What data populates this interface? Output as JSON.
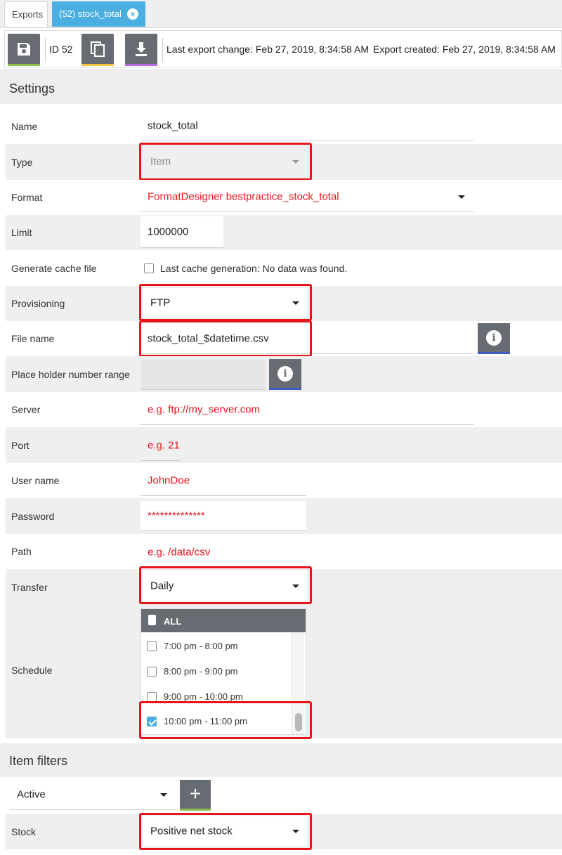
{
  "tabs": [
    {
      "label": "Exports"
    },
    {
      "label": "(52) stock_total",
      "close_icon": "close-circle-icon"
    }
  ],
  "toolbar": {
    "save_icon": "floppy-disk-icon",
    "id_text": "ID 52",
    "copy_icon": "copy-icon",
    "download_icon": "download-icon",
    "last_change": "Last export change: Feb 27, 2019, 8:34:58 AM",
    "created": "Export created: Feb 27, 2019, 8:34:58 AM",
    "colors": {
      "save": "#8bc34a",
      "copy": "#f5c542",
      "download": "#b86be0"
    }
  },
  "settings": {
    "title": "Settings",
    "name": {
      "label": "Name",
      "value": "stock_total"
    },
    "type": {
      "label": "Type",
      "value": "Item"
    },
    "format": {
      "label": "Format",
      "value": "FormatDesigner bestpractice_stock_total"
    },
    "limit": {
      "label": "Limit",
      "value": "1000000"
    },
    "cache": {
      "label": "Generate cache file",
      "text": "Last cache generation: No data was found."
    },
    "provisioning": {
      "label": "Provisioning",
      "value": "FTP"
    },
    "file_name": {
      "label": "File name",
      "value": "stock_total_$datetime.csv"
    },
    "placeholder_range": {
      "label": "Place holder number range",
      "value": ""
    },
    "server": {
      "label": "Server",
      "value": "e.g. ftp://my_server.com"
    },
    "port": {
      "label": "Port",
      "value": "e.g. 21"
    },
    "user": {
      "label": "User name",
      "value": "JohnDoe"
    },
    "password": {
      "label": "Password",
      "value": "**************"
    },
    "path": {
      "label": "Path",
      "value": "e.g. /data/csv"
    },
    "transfer": {
      "label": "Transfer",
      "value": "Daily"
    },
    "schedule": {
      "label": "Schedule",
      "all_label": "ALL",
      "items": [
        {
          "label": "7:00 pm - 8:00 pm",
          "checked": false
        },
        {
          "label": "8:00 pm - 9:00 pm",
          "checked": false
        },
        {
          "label": "9:00 pm - 10:00 pm",
          "checked": false
        },
        {
          "label": "10:00 pm - 11:00 pm",
          "checked": true
        }
      ]
    }
  },
  "item_filters": {
    "title": "Item filters",
    "active_select": "Active",
    "add_label": "+",
    "stock": {
      "label": "Stock",
      "value": "Positive net stock"
    }
  },
  "colors": {
    "accent": "#4aaee0",
    "highlight": "#e8141c",
    "button": "#676b72"
  }
}
